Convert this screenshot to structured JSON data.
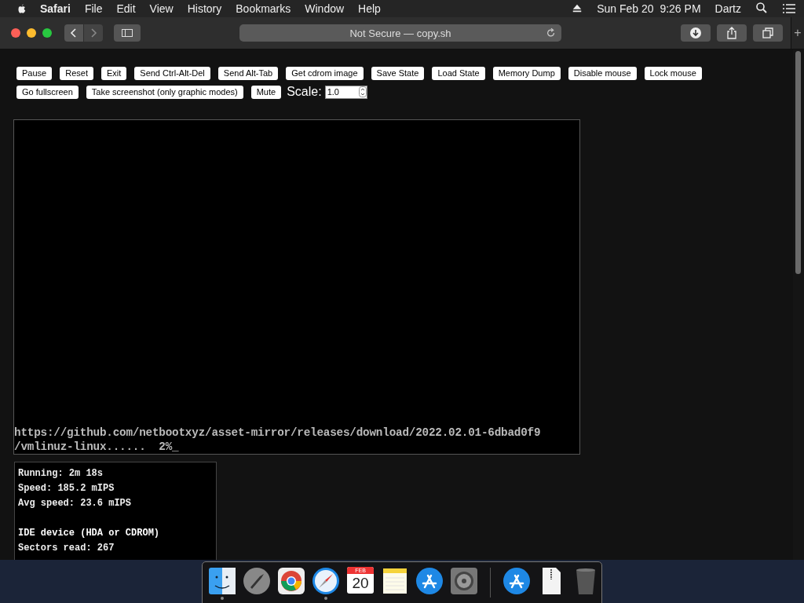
{
  "menu_bar": {
    "app": "Safari",
    "menus": [
      "File",
      "Edit",
      "View",
      "History",
      "Bookmarks",
      "Window",
      "Help"
    ],
    "clock": "Sun Feb 20  9:26 PM",
    "user": "Dartz"
  },
  "toolbar": {
    "forward_disabled": true,
    "address": "Not Secure — copy.sh",
    "new_tab": "+"
  },
  "controls": {
    "buttons": [
      "Pause",
      "Reset",
      "Exit",
      "Send Ctrl-Alt-Del",
      "Send Alt-Tab",
      "Get cdrom image",
      "Save State",
      "Load State",
      "Memory Dump",
      "Disable mouse",
      "Lock mouse",
      "Go fullscreen",
      "Take screenshot (only graphic modes)",
      "Mute"
    ],
    "scale": {
      "label": "Scale:",
      "value": "1.0"
    }
  },
  "screen": {
    "lines": [
      "https://github.com/netbootxyz/asset-mirror/releases/download/2022.02.01-6dbad0f9",
      "/vmlinuz-linux......  2%_"
    ]
  },
  "stats": [
    {
      "text": "Running: 2m 18s",
      "heading": false,
      "section_start": false
    },
    {
      "text": "Speed: 185.2 mIPS",
      "heading": false,
      "section_start": false
    },
    {
      "text": "Avg speed: 23.6 mIPS",
      "heading": false,
      "section_start": false
    },
    {
      "text": "IDE device (HDA or CDROM)",
      "heading": true,
      "section_start": true
    },
    {
      "text": "Sectors read: 267",
      "heading": false,
      "section_start": false
    }
  ],
  "dock": [
    {
      "kind": "finder",
      "running": true
    },
    {
      "kind": "launchpad",
      "running": false
    },
    {
      "kind": "chrome",
      "running": false
    },
    {
      "kind": "safari",
      "running": true
    },
    {
      "kind": "calendar",
      "running": false,
      "month": "FEB",
      "day": "20"
    },
    {
      "kind": "notes",
      "running": false
    },
    {
      "kind": "appstore",
      "running": false
    },
    {
      "kind": "settings",
      "running": false
    },
    {
      "kind": "separator"
    },
    {
      "kind": "appstore",
      "running": false
    },
    {
      "kind": "file",
      "running": false
    },
    {
      "kind": "trash",
      "running": false
    }
  ]
}
